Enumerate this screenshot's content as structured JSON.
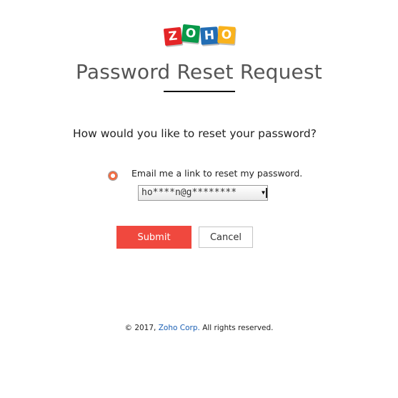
{
  "logo": {
    "letters": [
      "Z",
      "O",
      "H",
      "O"
    ],
    "colors": [
      "#e42527",
      "#089949",
      "#226db4",
      "#f9b21d"
    ]
  },
  "title": "Password Reset Request",
  "question": "How would you like to reset your password?",
  "option": {
    "label": "Email me a link to reset my password.",
    "selected": true
  },
  "email_select": {
    "value": "ho****n@g********"
  },
  "buttons": {
    "submit": "Submit",
    "cancel": "Cancel"
  },
  "footer": {
    "prefix": "© 2017,",
    "company_link": "Zoho Corp.",
    "suffix": "All rights reserved."
  },
  "colors": {
    "accent": "#f0483e",
    "link": "#1a5fb4"
  }
}
